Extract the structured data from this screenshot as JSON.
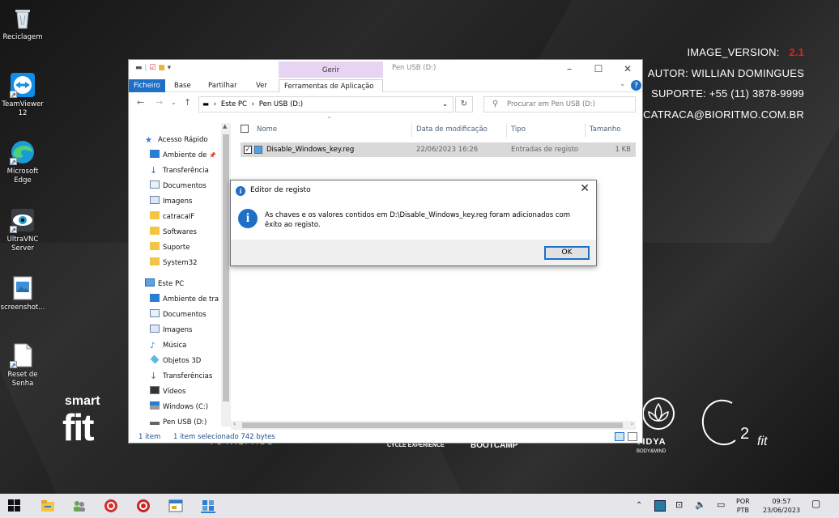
{
  "desktop": {
    "icons": [
      {
        "label": "Reciclagem"
      },
      {
        "label": "TeamViewer 12"
      },
      {
        "label": "Microsoft Edge"
      },
      {
        "label": "UltraVNC Server"
      },
      {
        "label": "screenshot..."
      },
      {
        "label": "Reset de Senha"
      }
    ],
    "overlay": {
      "image_version_label": "IMAGE_VERSION:",
      "image_version_value": "2.1",
      "author": "AUTOR: WILLIAN DOMINGUES",
      "support": "SUPORTE: +55 (11) 3878-9999",
      "email": "VCATRACA@BIORITMO.COM.BR"
    },
    "brands": {
      "smart": "smart",
      "fit": "fit",
      "totalpass": "TOTALPASS",
      "cycle": "CYCLE EXPERIENCE",
      "bootcamp": "BOOTCAMP",
      "vidya": "VIDYA",
      "vidya_sub": "BODY&MIND",
      "o2fit_num": "2",
      "o2fit_fit": "fit"
    }
  },
  "explorer": {
    "contextual_tab": "Gerir",
    "title": "Pen USB (D:)",
    "ribbon_tabs": [
      "Ficheiro",
      "Base",
      "Partilhar",
      "Ver",
      "Ferramentas de Aplicação"
    ],
    "address": {
      "seg1": "Este PC",
      "seg2": "Pen USB (D:)"
    },
    "search_placeholder": "Procurar em Pen USB (D:)",
    "nav": {
      "quick_access": "Acesso Rápido",
      "qa_items": [
        "Ambiente de",
        "Transferência",
        "Documentos",
        "Imagens",
        "catracaIF",
        "Softwares",
        "Suporte",
        "System32"
      ],
      "this_pc": "Este PC",
      "pc_items": [
        "Ambiente de tra",
        "Documentos",
        "Imagens",
        "Música",
        "Objetos 3D",
        "Transferências",
        "Vídeos",
        "Windows (C:)",
        "Pen USB (D:)"
      ]
    },
    "columns": [
      "Nome",
      "Data de modificação",
      "Tipo",
      "Tamanho"
    ],
    "files": [
      {
        "name": "Disable_Windows_key.reg",
        "modified": "22/06/2023 16:26",
        "type": "Entradas de registo",
        "size": "1 KB"
      }
    ],
    "status": {
      "count": "1 item",
      "selected": "1 item selecionado 742 bytes"
    }
  },
  "dialog": {
    "title": "Editor de registo",
    "message": "As chaves e os valores contidos em D:\\Disable_Windows_key.reg foram adicionados com êxito ao registo.",
    "ok": "OK"
  },
  "taskbar": {
    "lang1": "POR",
    "lang2": "PTB",
    "time": "09:57",
    "date": "23/06/2023"
  },
  "colors": {
    "accent": "#1e6fc6",
    "context_tab": "#e6d4f2",
    "overlay_red": "#e0251c"
  }
}
